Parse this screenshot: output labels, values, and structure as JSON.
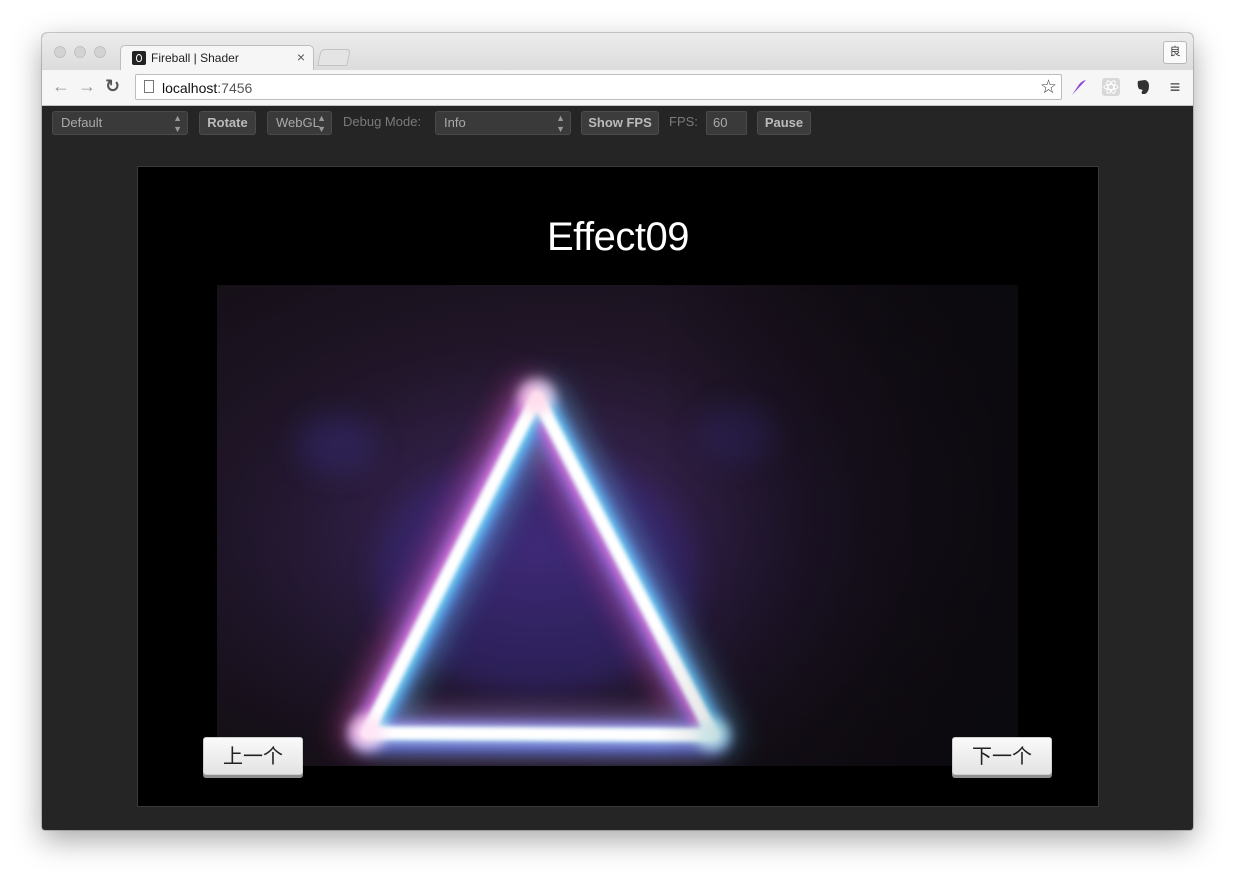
{
  "browser": {
    "tab_title": "Fireball | Shader",
    "tab_close": "×",
    "profile_label": "良",
    "url_host": "localhost",
    "url_port": ":7456"
  },
  "toolbar": {
    "scheme_select": "Default",
    "rotate_label": "Rotate",
    "renderer_select": "WebGL",
    "debug_mode_label": "Debug Mode:",
    "debug_mode_select": "Info",
    "show_fps_label": "Show FPS",
    "fps_label": "FPS:",
    "fps_value": "60",
    "pause_label": "Pause"
  },
  "stage": {
    "title": "Effect09",
    "prev_label": "上一个",
    "next_label": "下一个"
  },
  "colors": {
    "window_bg": "#252525",
    "stage_bg": "#000000",
    "glow_pink": "#ff3fb0",
    "glow_cyan": "#3ff0ff",
    "glow_blue": "#4a6bff"
  }
}
